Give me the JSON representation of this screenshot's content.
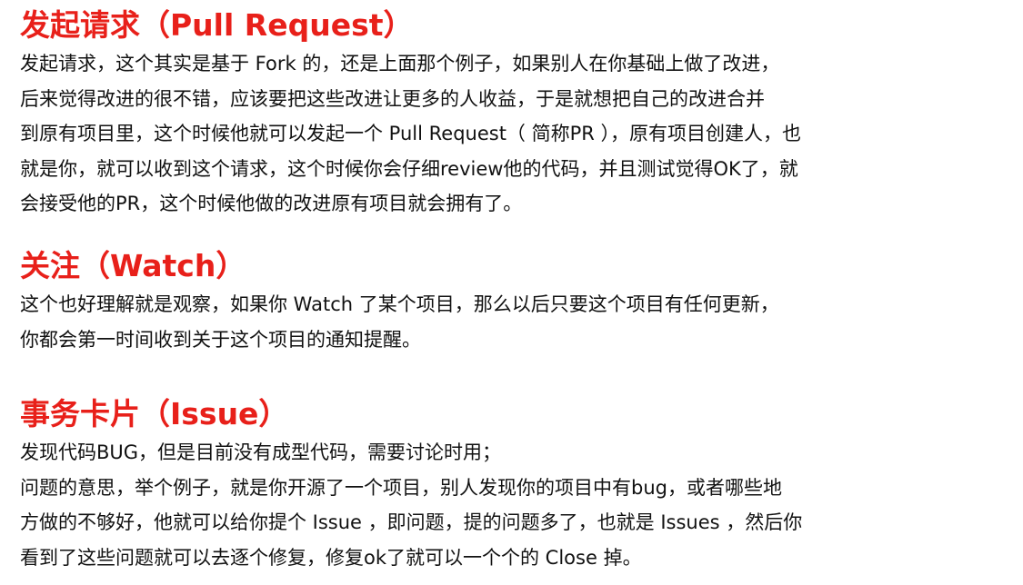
{
  "sections": [
    {
      "title": "发起请求（Pull Request）",
      "lines": [
        "发起请求，这个其实是基于 Fork 的，还是上面那个例子，如果别人在你基础上做了改进，",
        "后来觉得改进的很不错，应该要把这些改进让更多的人收益，于是就想把自己的改进合并",
        "到原有项目里，这个时候他就可以发起一个 Pull Request（ 简称PR ），原有项目创建人，也",
        "就是你，就可以收到这个请求，这个时候你会仔细review他的代码，并且测试觉得OK了，就",
        "会接受他的PR，这个时候他做的改进原有项目就会拥有了。"
      ]
    },
    {
      "title": "关注（Watch）",
      "lines": [
        "这个也好理解就是观察，如果你 Watch 了某个项目，那么以后只要这个项目有任何更新，",
        "你都会第一时间收到关于这个项目的通知提醒。"
      ]
    },
    {
      "title": "事务卡片（Issue）",
      "lines": [
        "发现代码BUG，但是目前没有成型代码，需要讨论时用；",
        "问题的意思，举个例子，就是你开源了一个项目，别人发现你的项目中有bug，或者哪些地",
        "方做的不够好，他就可以给你提个 Issue ，即问题，提的问题多了，也就是 Issues ，然后你",
        "看到了这些问题就可以去逐个修复，修复ok了就可以一个个的 Close 掉。"
      ]
    }
  ],
  "colors": {
    "heading": "#e8201a",
    "body_text": "#111111",
    "background": "#ffffff"
  }
}
